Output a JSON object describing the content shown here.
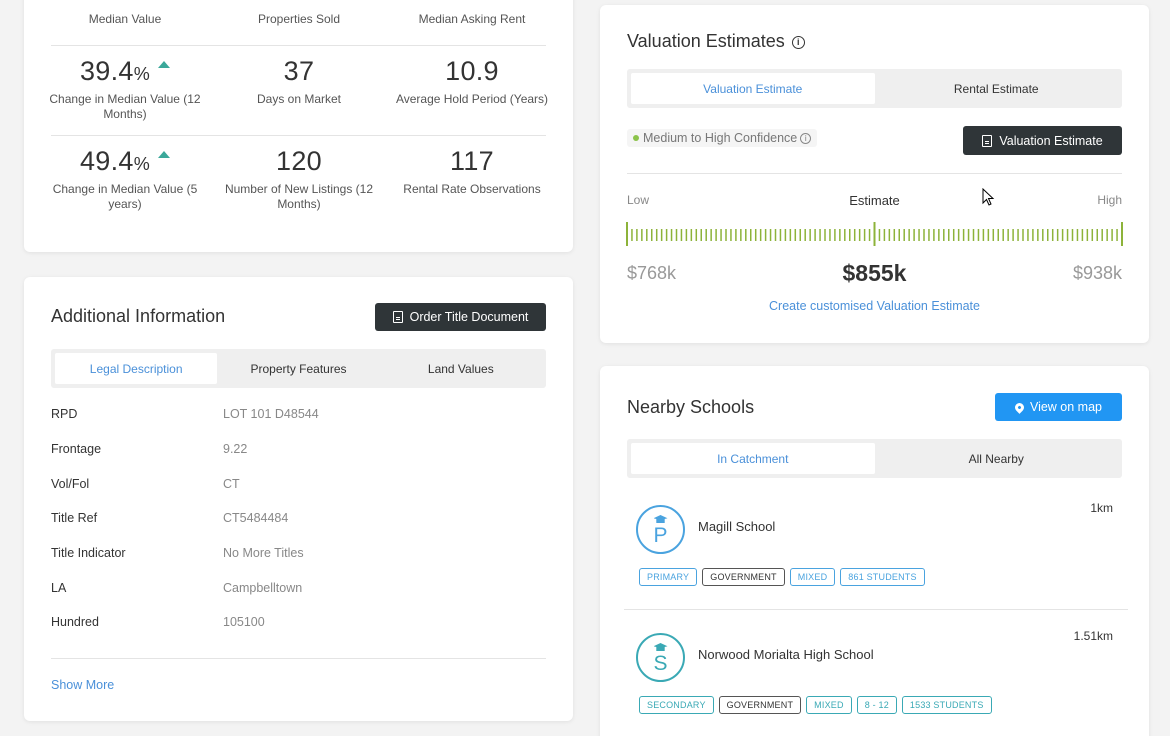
{
  "stats": {
    "headers": [
      "Median Value",
      "Properties Sold",
      "Median Asking Rent"
    ],
    "row1": [
      {
        "value": "39.4",
        "unit": "%",
        "label": "Change in Median Value (12 Months)"
      },
      {
        "value": "37",
        "label": "Days on Market"
      },
      {
        "value": "10.9",
        "label": "Average Hold Period (Years)"
      }
    ],
    "row2": [
      {
        "value": "49.4",
        "unit": "%",
        "label": "Change in Median Value (5 years)"
      },
      {
        "value": "120",
        "label": "Number of New Listings (12 Months)"
      },
      {
        "value": "117",
        "label": "Rental Rate Observations"
      }
    ],
    "trend_color": "#3aa89a"
  },
  "additional": {
    "title": "Additional Information",
    "order_button": "Order Title Document",
    "tabs": [
      "Legal Description",
      "Property Features",
      "Land Values"
    ],
    "rows": [
      {
        "key": "RPD",
        "value": "LOT 101 D48544"
      },
      {
        "key": "Frontage",
        "value": "9.22"
      },
      {
        "key": "Vol/Fol",
        "value": "CT"
      },
      {
        "key": "Title Ref",
        "value": "CT5484484"
      },
      {
        "key": "Title Indicator",
        "value": "No More Titles"
      },
      {
        "key": "LA",
        "value": "Campbelltown"
      },
      {
        "key": "Hundred",
        "value": "105100"
      }
    ],
    "show_more": "Show More"
  },
  "valuation": {
    "title": "Valuation Estimates",
    "tabs": [
      "Valuation Estimate",
      "Rental Estimate"
    ],
    "confidence": "Medium to High Confidence",
    "button": "Valuation Estimate",
    "low_label": "Low",
    "estimate_label": "Estimate",
    "high_label": "High",
    "low_value": "$768k",
    "estimate_value": "$855k",
    "high_value": "$938k",
    "link": "Create customised Valuation Estimate",
    "accent": "#8db33a"
  },
  "schools": {
    "title": "Nearby Schools",
    "map_button": "View on map",
    "tabs": [
      "In Catchment",
      "All Nearby"
    ],
    "list": [
      {
        "letter": "P",
        "name": "Magill School",
        "distance": "1km",
        "badges": [
          "PRIMARY",
          "GOVERNMENT",
          "MIXED",
          "861 STUDENTS"
        ]
      },
      {
        "letter": "S",
        "name": "Norwood Morialta High School",
        "distance": "1.51km",
        "badges": [
          "SECONDARY",
          "GOVERNMENT",
          "MIXED",
          "8 - 12",
          "1533 STUDENTS"
        ]
      }
    ]
  }
}
